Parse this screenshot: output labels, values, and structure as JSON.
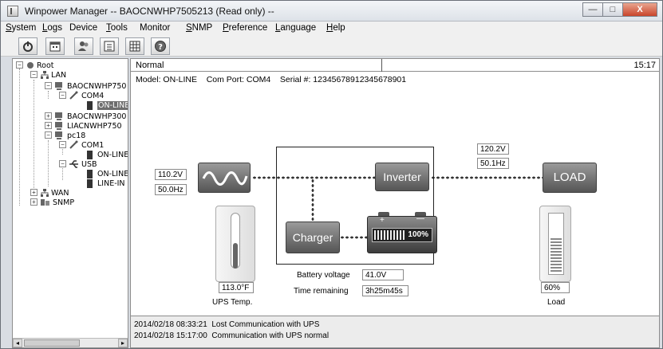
{
  "window": {
    "title": "Winpower Manager -- BAOCNWHP7505213 (Read only) --",
    "controls": {
      "minimize": "—",
      "maximize": "□",
      "close": "X"
    }
  },
  "menu": [
    {
      "label": "System",
      "mnemonic": "S",
      "rest": "ystem"
    },
    {
      "label": "Logs",
      "mnemonic": "L",
      "rest": "ogs"
    },
    {
      "label": "Device",
      "mnemonic": "",
      "rest": "Device"
    },
    {
      "label": "Tools",
      "mnemonic": "T",
      "rest": "ools"
    },
    {
      "label": "Monitor",
      "mnemonic": "",
      "rest": "Monitor"
    },
    {
      "label": "SNMP",
      "mnemonic": "S",
      "rest": "NMP"
    },
    {
      "label": "Preference",
      "mnemonic": "P",
      "rest": "reference"
    },
    {
      "label": "Language",
      "mnemonic": "L",
      "rest": "anguage"
    },
    {
      "label": "Help",
      "mnemonic": "H",
      "rest": "elp"
    }
  ],
  "toolbar": {
    "icons": [
      "power-icon",
      "calendar-icon",
      "users-icon",
      "list-icon",
      "table-icon",
      "help-icon"
    ]
  },
  "tree": {
    "root": "Root",
    "lan": "LAN",
    "host1": "BAOCNWHP750",
    "com4": "COM4",
    "online1": "ON-LINE",
    "host2": "BAOCNWHP300",
    "host3": "LIACNWHP750",
    "pc18": "pc18",
    "com1": "COM1",
    "online2": "ON-LINE",
    "usb": "USB",
    "online3": "ON-LINE",
    "linein": "LINE-IN",
    "wan": "WAN",
    "snmp": "SNMP"
  },
  "status": {
    "mode": "Normal",
    "time": "15:17"
  },
  "device": {
    "model_line": "Model: ON-LINE    Com Port: COM4    Serial #: 12345678912345678901"
  },
  "input": {
    "voltage": "110.2V",
    "frequency": "50.0Hz"
  },
  "output": {
    "voltage": "120.2V",
    "frequency": "50.1Hz"
  },
  "blocks": {
    "inverter": "Inverter",
    "load": "LOAD",
    "charger": "Charger",
    "battery_percent": "100%",
    "battery_plus": "+",
    "battery_minus": "—"
  },
  "battery": {
    "voltage_label": "Battery voltage",
    "voltage_value": "41.0V",
    "time_label": "Time remaining",
    "time_value": "3h25m45s",
    "level_percent": 100
  },
  "temperature": {
    "value": "113.0°F",
    "caption": "UPS Temp."
  },
  "load": {
    "value": "60%",
    "caption": "Load",
    "level_percent": 60
  },
  "logs": [
    {
      "time": "2014/02/18 08:33:21",
      "text": "Lost Communication with UPS"
    },
    {
      "time": "2014/02/18 15:17:00",
      "text": "Communication with UPS normal"
    }
  ]
}
